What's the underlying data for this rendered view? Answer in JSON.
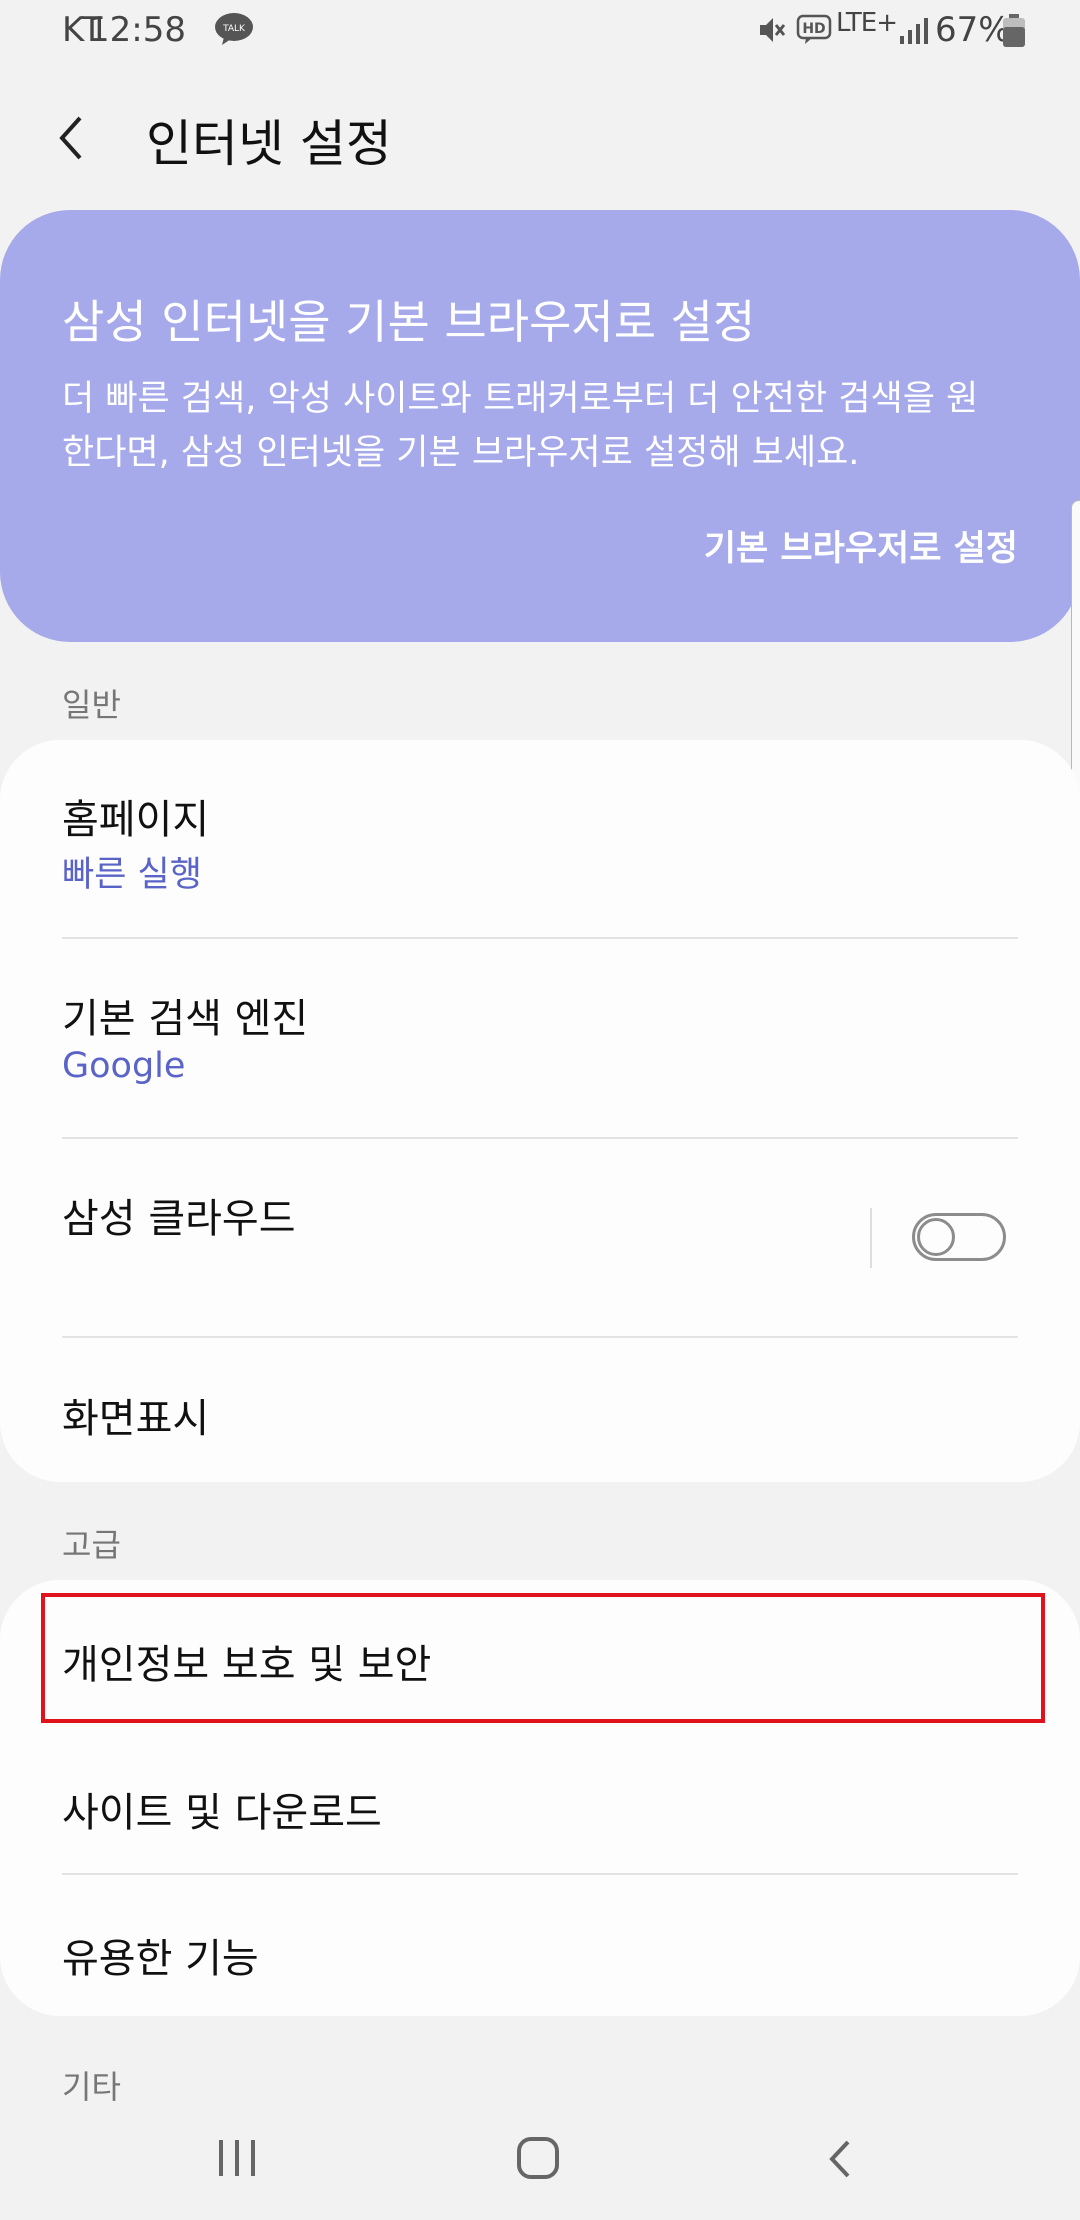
{
  "status_bar": {
    "carrier": "KT",
    "time": "12:58",
    "talk_badge": "TALK",
    "hd_badge": "HD",
    "network": "LTE+",
    "battery": "67%",
    "icons": [
      "kakaotalk-icon",
      "mute-icon",
      "hd-voice-icon",
      "signal-icon",
      "battery-icon"
    ]
  },
  "header": {
    "title": "인터넷 설정"
  },
  "banner": {
    "title": "삼성 인터넷을 기본 브라우저로 설정",
    "description": "더 빠른 검색, 악성 사이트와 트래커로부터 더 안전한 검색을 원한다면, 삼성 인터넷을 기본 브라우저로 설정해 보세요.",
    "action": "기본 브라우저로 설정",
    "color": "#a6a9ea"
  },
  "sections": {
    "general": {
      "label": "일반",
      "items": [
        {
          "title": "홈페이지",
          "subtitle": "빠른 실행"
        },
        {
          "title": "기본 검색 엔진",
          "subtitle": "Google"
        },
        {
          "title": "삼성 클라우드",
          "toggle": false
        },
        {
          "title": "화면표시"
        }
      ]
    },
    "advanced": {
      "label": "고급",
      "items": [
        {
          "title": "개인정보 보호 및 보안",
          "highlighted": true
        },
        {
          "title": "사이트 및 다운로드"
        },
        {
          "title": "유용한 기능"
        }
      ]
    },
    "other": {
      "label": "기타"
    }
  },
  "colors": {
    "accent": "#5a63c8",
    "highlight": "#e0121b",
    "background": "#f2f2f2"
  }
}
